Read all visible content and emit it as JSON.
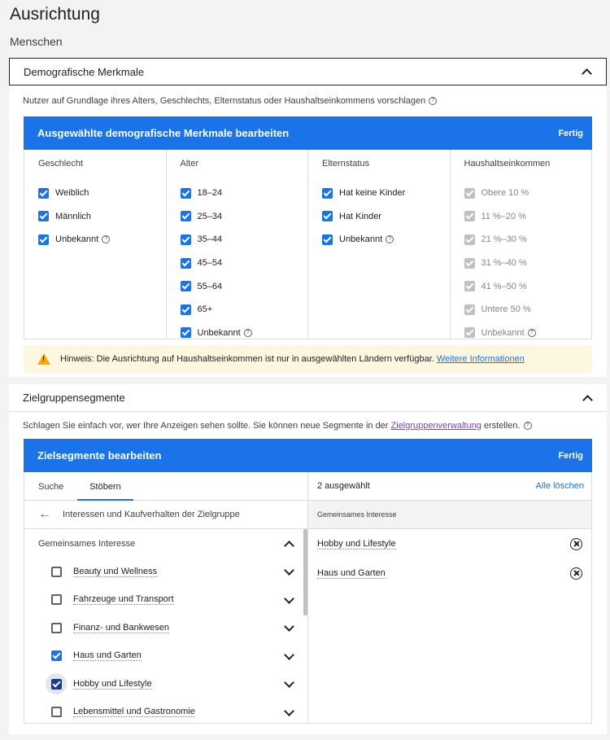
{
  "page": {
    "title": "Ausrichtung",
    "subtitle": "Menschen"
  },
  "demographics": {
    "header": "Demografische Merkmale",
    "description": "Nutzer auf Grundlage ihres Alters, Geschlechts, Elternstatus oder Haushaltseinkommens vorschlagen",
    "edit_title": "Ausgewählte demografische Merkmale bearbeiten",
    "done_label": "Fertig",
    "columns": [
      {
        "title": "Geschlecht",
        "options": [
          {
            "label": "Weiblich",
            "checked": true
          },
          {
            "label": "Männlich",
            "checked": true
          },
          {
            "label": "Unbekannt",
            "checked": true,
            "help": true
          }
        ]
      },
      {
        "title": "Alter",
        "options": [
          {
            "label": "18–24",
            "checked": true
          },
          {
            "label": "25–34",
            "checked": true
          },
          {
            "label": "35–44",
            "checked": true
          },
          {
            "label": "45–54",
            "checked": true
          },
          {
            "label": "55–64",
            "checked": true
          },
          {
            "label": "65+",
            "checked": true
          },
          {
            "label": "Unbekannt",
            "checked": true,
            "help": true
          }
        ]
      },
      {
        "title": "Elternstatus",
        "options": [
          {
            "label": "Hat keine Kinder",
            "checked": true
          },
          {
            "label": "Hat Kinder",
            "checked": true
          },
          {
            "label": "Unbekannt",
            "checked": true,
            "help": true
          }
        ]
      },
      {
        "title": "Haushaltseinkommen",
        "disabled": true,
        "options": [
          {
            "label": "Obere 10 %",
            "checked": true
          },
          {
            "label": "11 %–20 %",
            "checked": true
          },
          {
            "label": "21 %–30 %",
            "checked": true
          },
          {
            "label": "31 %–40 %",
            "checked": true
          },
          {
            "label": "41 %–50 %",
            "checked": true
          },
          {
            "label": "Untere 50 %",
            "checked": true
          },
          {
            "label": "Unbekannt",
            "checked": true,
            "help": true
          }
        ]
      }
    ],
    "notice_text": "Hinweis: Die Ausrichtung auf Haushaltseinkommen ist nur in ausgewählten Ländern verfügbar.",
    "notice_link": "Weitere Informationen"
  },
  "segments": {
    "header": "Zielgruppensegmente",
    "description_pre": "Schlagen Sie einfach vor, wer Ihre Anzeigen sehen sollte.  Sie können neue Segmente in der",
    "description_link": "Zielgruppenverwaltung",
    "description_post": "erstellen.",
    "edit_title": "Zielsegmente bearbeiten",
    "done_label": "Fertig",
    "tabs": [
      "Suche",
      "Stöbern"
    ],
    "back_label": "Interessen und Kaufverhalten der Zielgruppe",
    "group_label": "Gemeinsames Interesse",
    "items": [
      {
        "label": "Beauty und Wellness",
        "checked": false
      },
      {
        "label": "Fahrzeuge und Transport",
        "checked": false
      },
      {
        "label": "Finanz- und Bankwesen",
        "checked": false
      },
      {
        "label": "Haus und Garten",
        "checked": true
      },
      {
        "label": "Hobby und Lifestyle",
        "checked": true,
        "focused": true
      },
      {
        "label": "Lebensmittel und Gastronomie",
        "checked": false
      }
    ],
    "selected_count": "2 ausgewählt",
    "clear_all": "Alle löschen",
    "selected_category": "Gemeinsames Interesse",
    "selected": [
      "Hobby und Lifestyle",
      "Haus und Garten"
    ]
  }
}
